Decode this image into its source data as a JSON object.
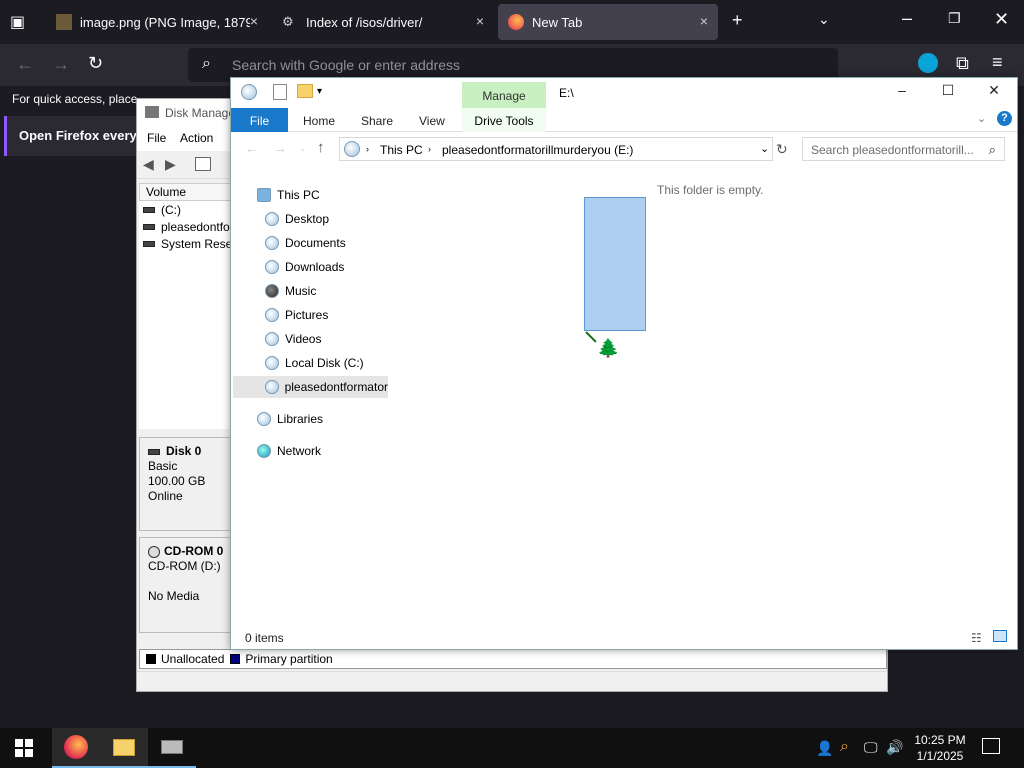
{
  "firefox": {
    "tabs": [
      {
        "title": "image.png (PNG Image, 1879 ×",
        "close": "×"
      },
      {
        "title": "Index of /isos/driver/",
        "close": "×"
      },
      {
        "title": "New Tab",
        "close": "×"
      }
    ],
    "new_tab": "+",
    "url_placeholder": "Search with Google or enter address",
    "quick_access_text": "For quick access, place",
    "banner_text": "Open Firefox every ti"
  },
  "disk_mgmt": {
    "title": "Disk Manage",
    "menu": [
      "File",
      "Action"
    ],
    "column_volume": "Volume",
    "volumes": [
      "(C:)",
      "pleasedontfor",
      "System Reserv"
    ],
    "disk0": {
      "name": "Disk 0",
      "type": "Basic",
      "size": "100.00 GB",
      "status": "Online"
    },
    "cdrom0": {
      "name": "CD-ROM 0",
      "type": "CD-ROM (D:)",
      "status": "No Media"
    },
    "legend": [
      {
        "label": "Unallocated",
        "color": "#000000"
      },
      {
        "label": "Primary partition",
        "color": "#000080"
      }
    ]
  },
  "explorer": {
    "title_path": "E:\\",
    "manage_tab": "Manage",
    "drive_tools_tab": "Drive Tools",
    "ribbon_tabs": [
      "File",
      "Home",
      "Share",
      "View"
    ],
    "breadcrumb": [
      "This PC",
      "pleasedontformatorillmurderyou (E:)"
    ],
    "search_placeholder": "Search pleasedontformatorill...",
    "nav": [
      {
        "label": "This PC",
        "level": 0
      },
      {
        "label": "Desktop",
        "level": 1
      },
      {
        "label": "Documents",
        "level": 1
      },
      {
        "label": "Downloads",
        "level": 1
      },
      {
        "label": "Music",
        "level": 1
      },
      {
        "label": "Pictures",
        "level": 1
      },
      {
        "label": "Videos",
        "level": 1
      },
      {
        "label": "Local Disk (C:)",
        "level": 1
      },
      {
        "label": "pleasedontformator",
        "level": 1,
        "selected": true
      },
      {
        "label": "Libraries",
        "level": 0
      },
      {
        "label": "Network",
        "level": 0
      }
    ],
    "empty_message": "This folder is empty.",
    "item_count": "0 items",
    "accent": "#1979ca"
  },
  "taskbar": {
    "time": "10:25 PM",
    "date": "1/1/2025"
  }
}
